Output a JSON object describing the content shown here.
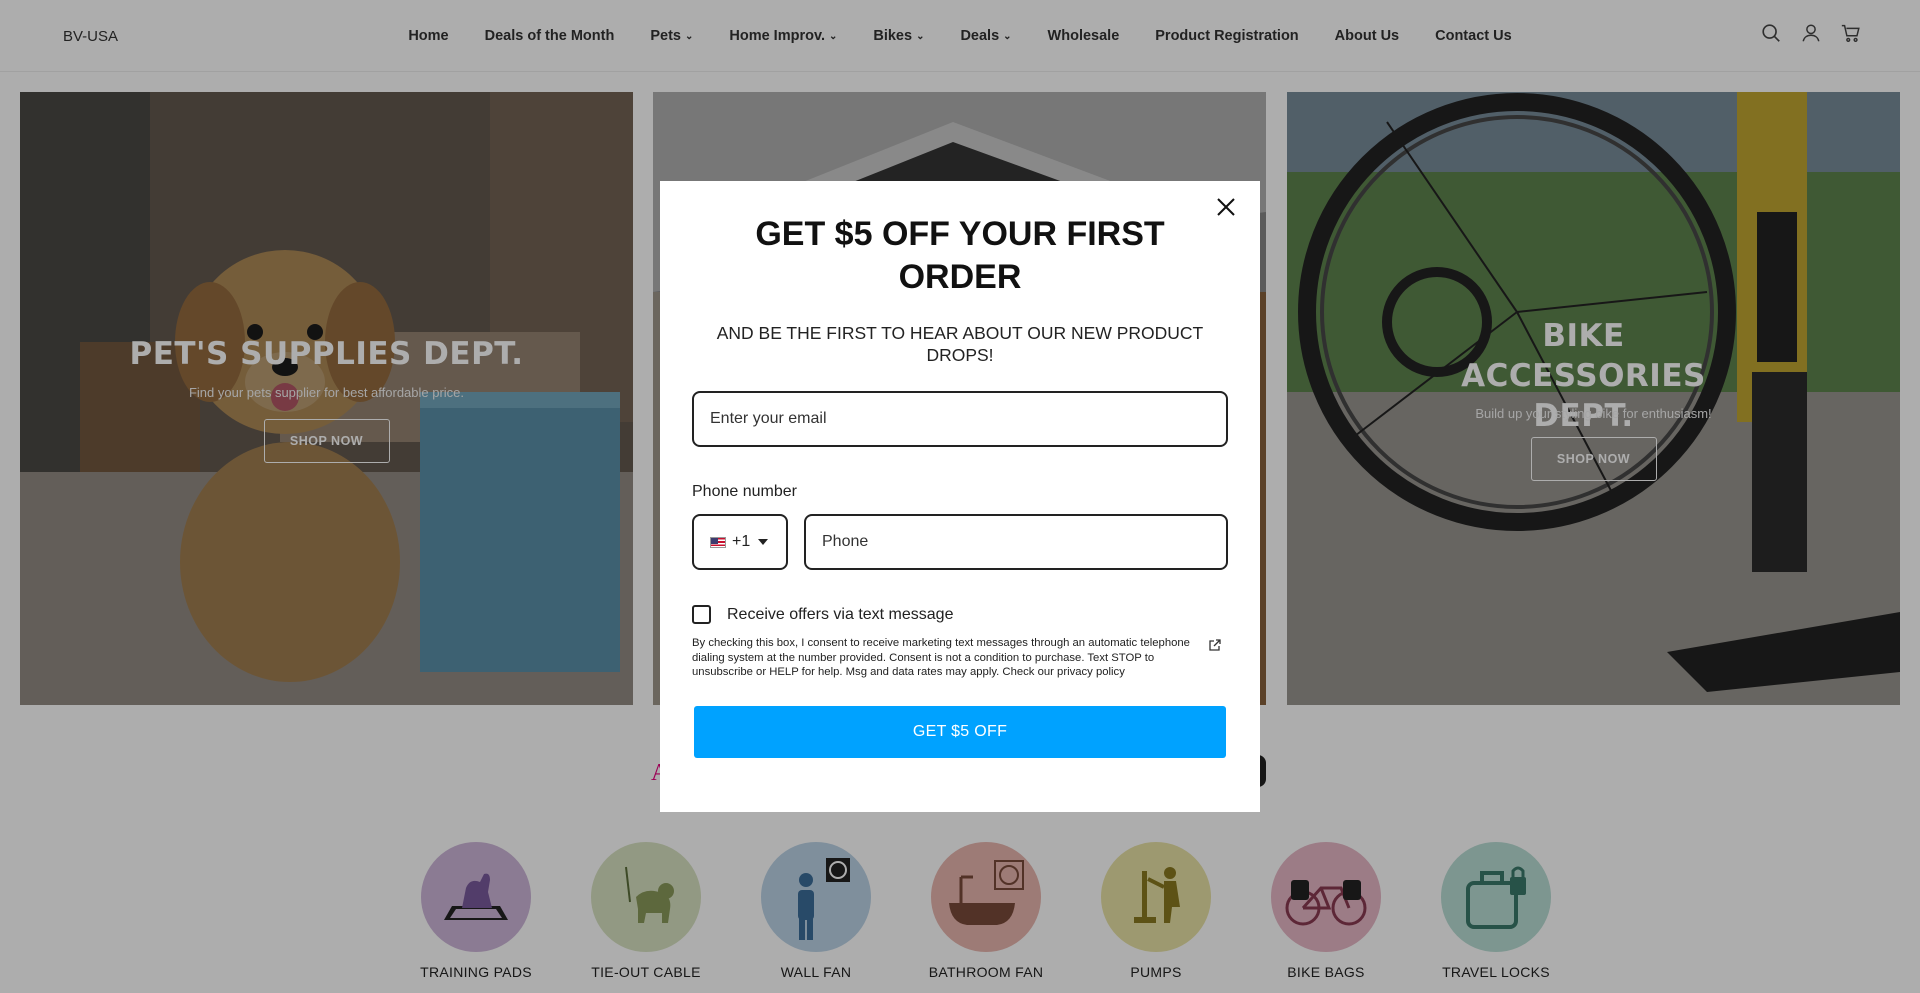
{
  "header": {
    "logo": "BV-USA",
    "nav": [
      {
        "label": "Home",
        "dropdown": false
      },
      {
        "label": "Deals of the Month",
        "dropdown": false
      },
      {
        "label": "Pets",
        "dropdown": true
      },
      {
        "label": "Home Improv.",
        "dropdown": true
      },
      {
        "label": "Bikes",
        "dropdown": true
      },
      {
        "label": "Deals",
        "dropdown": true
      },
      {
        "label": "Wholesale",
        "dropdown": false
      },
      {
        "label": "Product Registration",
        "dropdown": false
      },
      {
        "label": "About Us",
        "dropdown": false
      },
      {
        "label": "Contact Us",
        "dropdown": false
      }
    ],
    "icons": [
      "search-icon",
      "account-icon",
      "cart-icon"
    ]
  },
  "banners": [
    {
      "title": "PET'S SUPPLIES DEPT.",
      "subtitle": "Find your pets supplier for best affordable price.",
      "button": "SHOP NOW"
    },
    {
      "title": "",
      "subtitle": "",
      "button": ""
    },
    {
      "title": "BIKE ACCESSORIES DEPT.",
      "subtitle": "Build up your styling bike for enthusiasm!",
      "button": "SHOP NOW"
    }
  ],
  "categories": {
    "heading_fragment": "A",
    "items": [
      {
        "label": "TRAINING PADS",
        "color": "#cdb6d9"
      },
      {
        "label": "TIE-OUT CABLE",
        "color": "#d8e2c2"
      },
      {
        "label": "WALL FAN",
        "color": "#bcd3e6"
      },
      {
        "label": "BATHROOM FAN",
        "color": "#e8b5ae"
      },
      {
        "label": "PUMPS",
        "color": "#e8e2a5"
      },
      {
        "label": "BIKE BAGS",
        "color": "#e6b7c6"
      },
      {
        "label": "TRAVEL LOCKS",
        "color": "#b9ddd4"
      }
    ]
  },
  "modal": {
    "headline": "GET $5 OFF YOUR FIRST ORDER",
    "subheadline": "AND BE THE FIRST TO HEAR ABOUT OUR NEW PRODUCT DROPS!",
    "email_placeholder": "Enter your email",
    "phone_label": "Phone number",
    "country_code": "+1",
    "phone_placeholder": "Phone",
    "sms_label": "Receive offers via text message",
    "consent_text": "By checking this box, I consent to receive marketing text messages through an automatic telephone dialing system at the number provided. Consent is not a condition to purchase. Text STOP to unsubscribe or HELP for help. Msg and data rates may apply. Check our privacy policy",
    "cta": "GET $5 OFF",
    "cta_color": "#00a2ff"
  }
}
